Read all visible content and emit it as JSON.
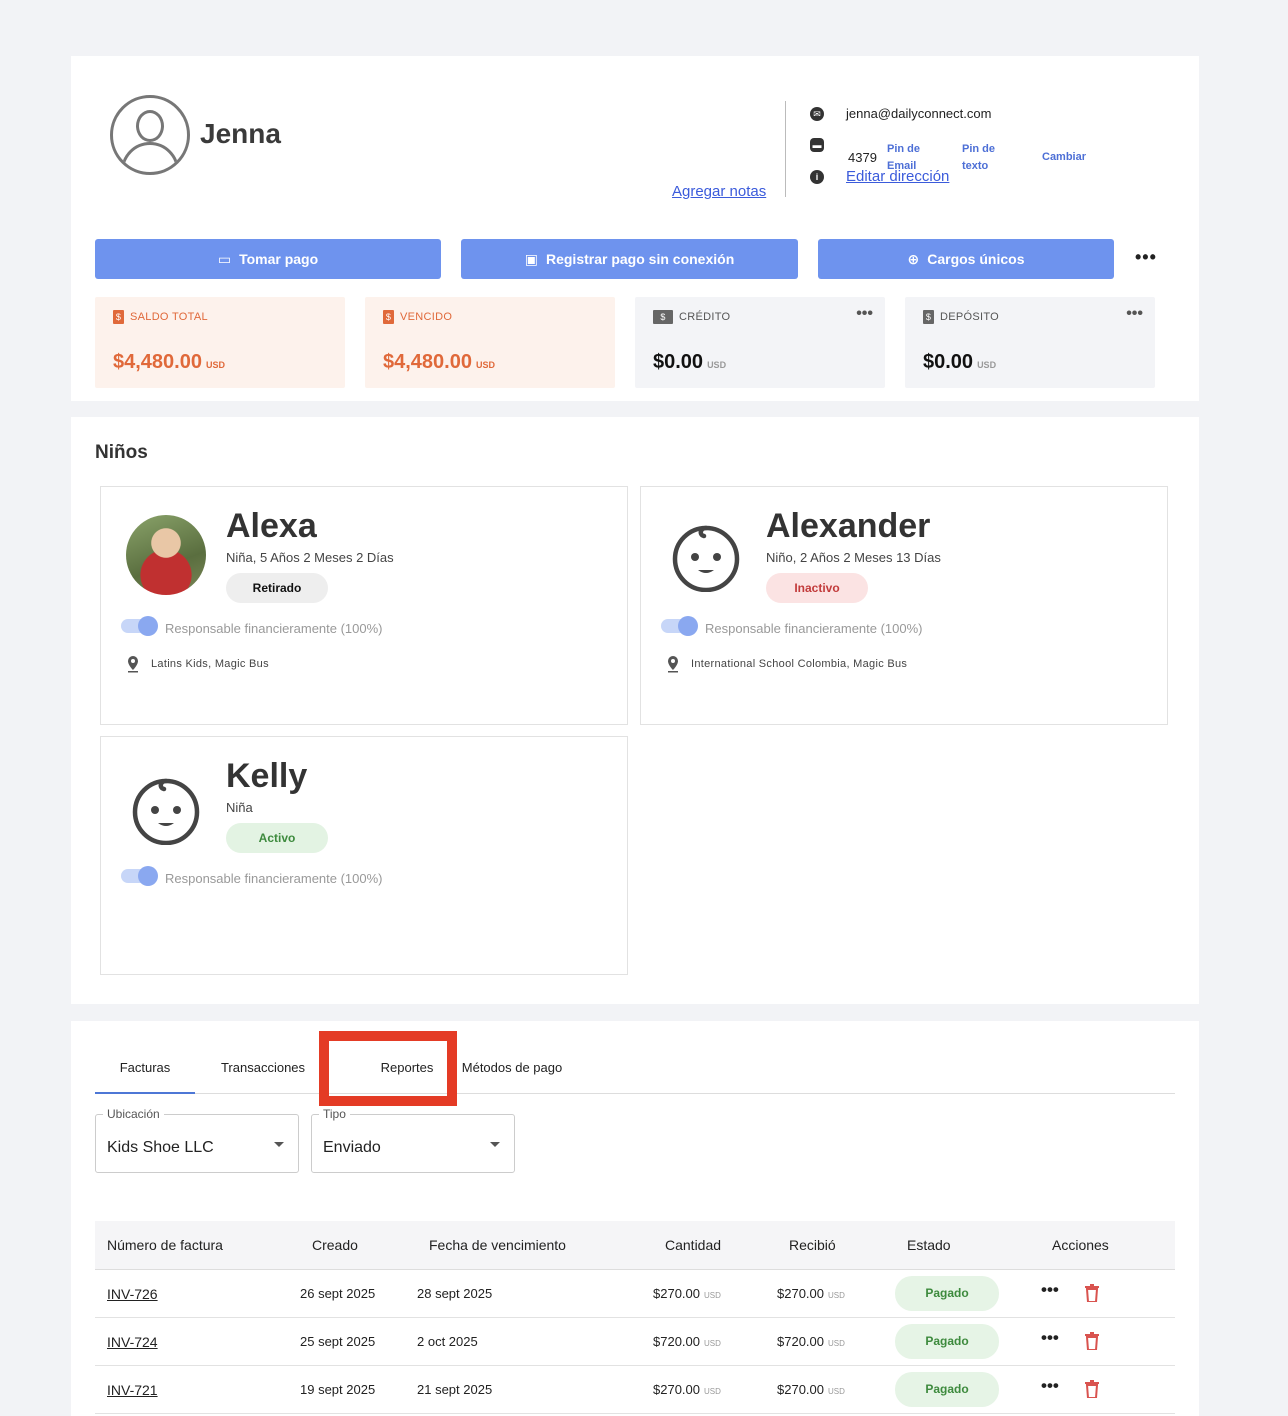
{
  "profile": {
    "name": "Jenna",
    "add_notes": "Agregar notas",
    "email": "jenna@dailyconnect.com",
    "phone": "4379",
    "email_pin": "Pin de Email",
    "text_pin": "Pin de texto",
    "change": "Cambiar",
    "edit_address": "Editar dirección"
  },
  "actions": {
    "take_payment": "Tomar pago",
    "offline_payment": "Registrar pago sin conexión",
    "one_time_charges": "Cargos únicos"
  },
  "stats": [
    {
      "label": "SALDO TOTAL",
      "value": "$4,480.00",
      "currency": "USD"
    },
    {
      "label": "VENCIDO",
      "value": "$4,480.00",
      "currency": "USD"
    },
    {
      "label": "CRÉDITO",
      "value": "$0.00",
      "currency": "USD"
    },
    {
      "label": "DEPÓSITO",
      "value": "$0.00",
      "currency": "USD"
    }
  ],
  "kids": {
    "title": "Niños",
    "items": [
      {
        "name": "Alexa",
        "info": "Niña, 5 Años 2 Meses 2 Días",
        "status": "Retirado",
        "responsible": "Responsable financieramente (100%)",
        "locations": "Latins Kids, Magic Bus"
      },
      {
        "name": "Alexander",
        "info": "Niño, 2 Años 2 Meses 13 Días",
        "status": "Inactivo",
        "responsible": "Responsable financieramente (100%)",
        "locations": "International School Colombia, Magic Bus"
      },
      {
        "name": "Kelly",
        "info": "Niña",
        "status": "Activo",
        "responsible": "Responsable financieramente (100%)"
      }
    ]
  },
  "tabs": [
    "Facturas",
    "Transacciones",
    "Reportes",
    "Métodos de pago"
  ],
  "filters": {
    "location_label": "Ubicación",
    "location_value": "Kids Shoe LLC",
    "type_label": "Tipo",
    "type_value": "Enviado"
  },
  "table": {
    "headers": [
      "Número de factura",
      "Creado",
      "Fecha de vencimiento",
      "Cantidad",
      "Recibió",
      "Estado",
      "Acciones"
    ],
    "rows": [
      {
        "invoice": "INV-726",
        "created": "26 sept 2025",
        "due": "28 sept 2025",
        "amount": "$270.00",
        "received": "$270.00",
        "currency": "USD",
        "status": "Pagado"
      },
      {
        "invoice": "INV-724",
        "created": "25 sept 2025",
        "due": "2 oct 2025",
        "amount": "$720.00",
        "received": "$720.00",
        "currency": "USD",
        "status": "Pagado"
      },
      {
        "invoice": "INV-721",
        "created": "19 sept 2025",
        "due": "21 sept 2025",
        "amount": "$270.00",
        "received": "$270.00",
        "currency": "USD",
        "status": "Pagado"
      }
    ]
  },
  "colors": {
    "primary_button": "#6e93ee",
    "balance_orange": "#e0693a",
    "highlight_box": "#e43b25"
  }
}
